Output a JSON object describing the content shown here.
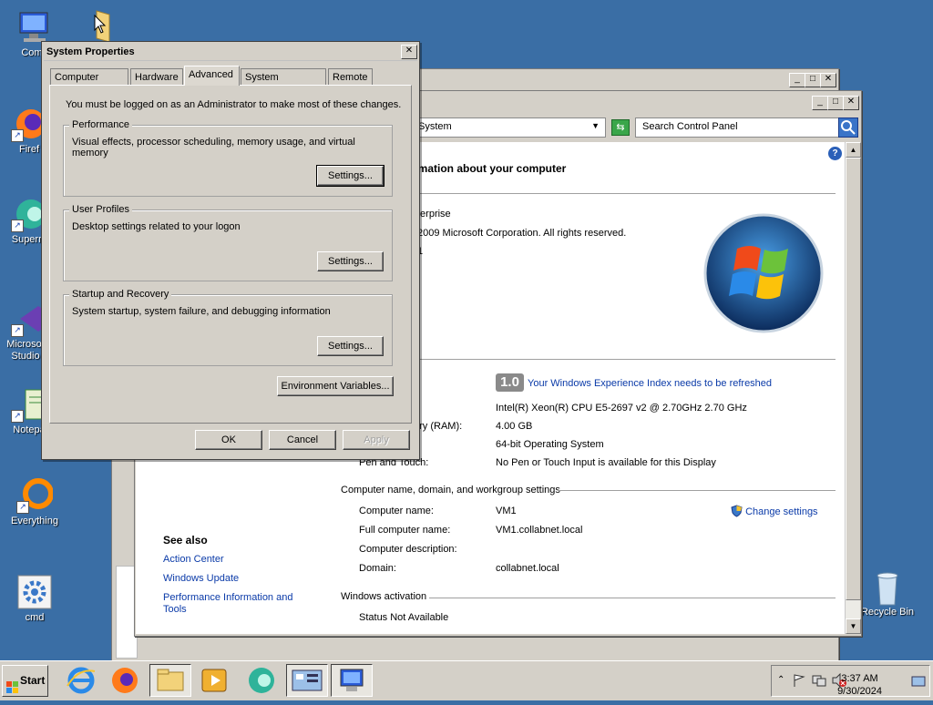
{
  "desktop": {
    "icons": [
      {
        "label": "Comp"
      },
      {
        "label": "Firef"
      },
      {
        "label": "Superm"
      },
      {
        "label": "Microsof Studio"
      },
      {
        "label": "Notepa"
      },
      {
        "label": "Everything"
      },
      {
        "label": "cmd"
      },
      {
        "label": "Recycle Bin"
      }
    ]
  },
  "control_panel": {
    "address": "System",
    "search_placeholder": "Search Control Panel",
    "heading": "rmation about your computer",
    "edition_line": "terprise",
    "copyright": "2009 Microsoft Corporation.  All rights reserved.",
    "edition_extra": "1",
    "wei_score": "1.0",
    "wei_link": "Your Windows Experience Index needs to be refreshed",
    "processor": "Intel(R) Xeon(R) CPU E5-2697 v2 @ 2.70GHz   2.70 GHz",
    "memory_label": "ory (RAM):",
    "memory": "4.00 GB",
    "system_type": "64-bit Operating System",
    "pen_label": "Pen and Touch:",
    "pen": "No Pen or Touch Input is available for this Display",
    "section_computer": "Computer name, domain, and workgroup settings",
    "computer_name_label": "Computer name:",
    "computer_name": "VM1",
    "change_settings": "Change settings",
    "full_name_label": "Full computer name:",
    "full_name": "VM1.collabnet.local",
    "description_label": "Computer description:",
    "domain_label": "Domain:",
    "domain": "collabnet.local",
    "section_activation": "Windows activation",
    "status": "Status Not Available",
    "see_also": "See also",
    "see_also_links": [
      "Action Center",
      "Windows Update",
      "Performance Information and",
      "Tools"
    ]
  },
  "dialog": {
    "title": "System Properties",
    "tabs": [
      "Computer Name",
      "Hardware",
      "Advanced",
      "System Protection",
      "Remote"
    ],
    "admin_note": "You must be logged on as an Administrator to make most of these changes.",
    "performance": {
      "legend": "Performance",
      "desc": "Visual effects, processor scheduling, memory usage, and virtual memory",
      "button": "Settings..."
    },
    "user_profiles": {
      "legend": "User Profiles",
      "desc": "Desktop settings related to your logon",
      "button": "Settings..."
    },
    "startup": {
      "legend": "Startup and Recovery",
      "desc": "System startup, system failure, and debugging information",
      "button": "Settings..."
    },
    "env_button": "Environment Variables...",
    "ok": "OK",
    "cancel": "Cancel",
    "apply": "Apply",
    "close_glyph": "✕"
  },
  "taskbar": {
    "start": "Start",
    "time": "3:37 AM",
    "date": "9/30/2024"
  },
  "colors": {
    "desktop": "#3a6ea5",
    "link": "#0a3aa8"
  }
}
